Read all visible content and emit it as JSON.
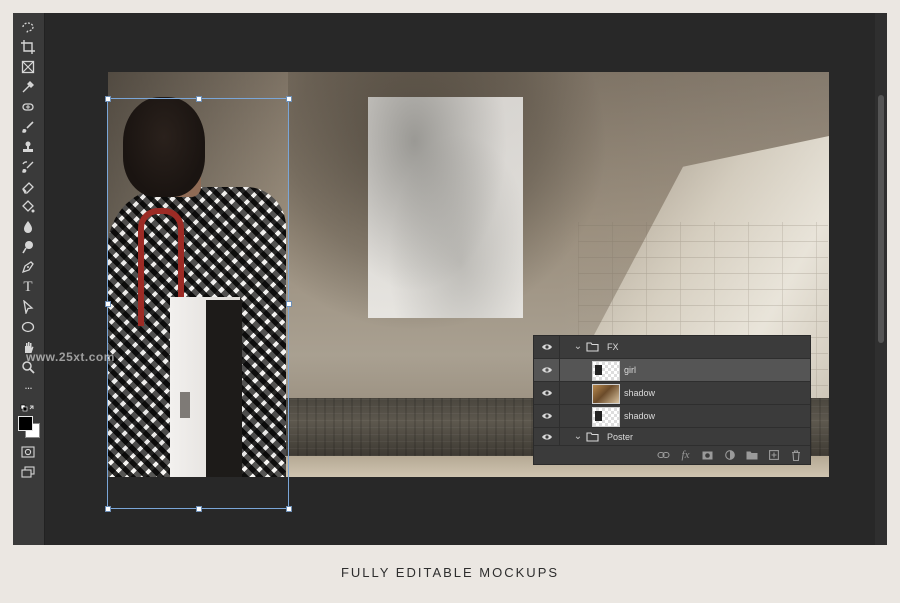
{
  "toolbar": {
    "tools": [
      {
        "name": "lasso-tool-icon",
        "glyph": "◌"
      },
      {
        "name": "crop-tool-icon",
        "glyph": "⌗"
      },
      {
        "name": "frame-tool-icon",
        "glyph": "⊠"
      },
      {
        "name": "eyedropper-tool-icon",
        "glyph": "✎"
      },
      {
        "name": "healing-brush-icon",
        "glyph": "⊛"
      },
      {
        "name": "brush-tool-icon",
        "glyph": "/"
      },
      {
        "name": "clone-stamp-icon",
        "glyph": "♟"
      },
      {
        "name": "history-brush-icon",
        "glyph": "↯"
      },
      {
        "name": "eraser-tool-icon",
        "glyph": "◇"
      },
      {
        "name": "paint-bucket-icon",
        "glyph": "⛾"
      },
      {
        "name": "blur-tool-icon",
        "glyph": "❦"
      },
      {
        "name": "dodge-tool-icon",
        "glyph": "⚲"
      },
      {
        "name": "pen-tool-icon",
        "glyph": "✒"
      },
      {
        "name": "type-tool-icon",
        "glyph": "T"
      },
      {
        "name": "path-selection-icon",
        "glyph": "➤"
      },
      {
        "name": "shape-tool-icon",
        "glyph": "○"
      },
      {
        "name": "hand-tool-icon",
        "glyph": "✋"
      },
      {
        "name": "zoom-tool-icon",
        "glyph": "⚲"
      },
      {
        "name": "more-tools-icon",
        "glyph": "···"
      }
    ]
  },
  "watermark": "www.25xt.com",
  "layers": [
    {
      "name": "FX",
      "kind": "group"
    },
    {
      "name": "girl",
      "kind": "layer",
      "thumb": "mask",
      "selected": true
    },
    {
      "name": "shadow",
      "kind": "layer",
      "thumb": "photo"
    },
    {
      "name": "shadow",
      "kind": "layer",
      "thumb": "mask"
    },
    {
      "name": "Poster",
      "kind": "group"
    }
  ],
  "panel_footer": {
    "icons": [
      "link-layers-icon",
      "fx-icon",
      "layer-mask-icon",
      "adjustment-layer-icon",
      "new-group-icon",
      "new-layer-icon",
      "delete-layer-icon"
    ],
    "fx_label": "fx"
  },
  "caption": "FULLY EDITABLE MOCKUPS",
  "colors": {
    "background": "#ebe7e2",
    "workspace": "#282828",
    "panel": "#3b3b3b",
    "selection": "#7aa6d8",
    "strap": "#9c2b25"
  }
}
